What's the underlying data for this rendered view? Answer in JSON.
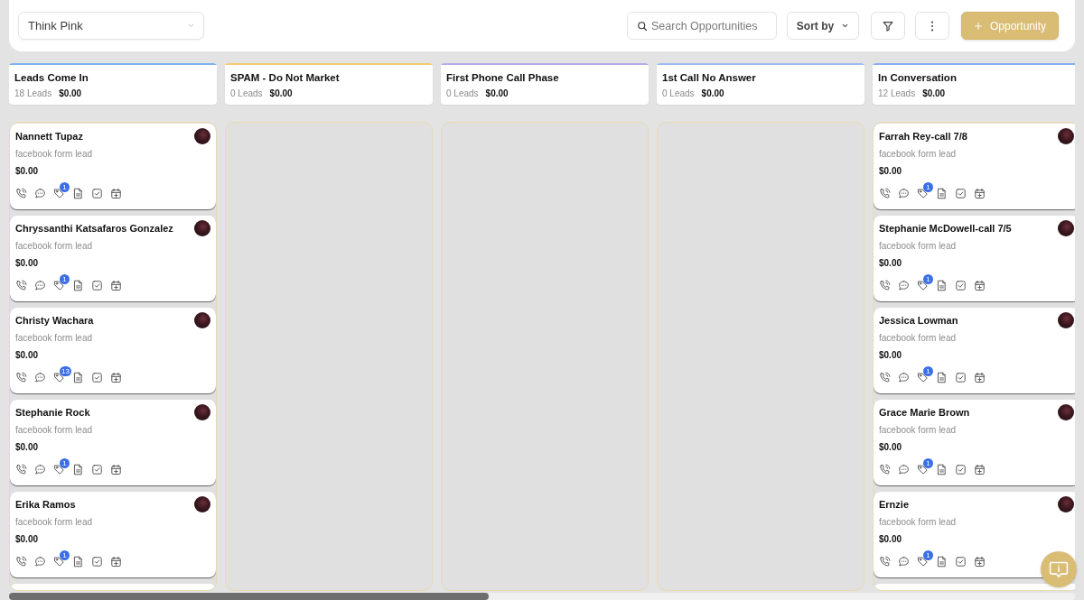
{
  "pipeline_select": {
    "value": "Think Pink"
  },
  "toolbar": {
    "search": {
      "placeholder": "Search Opportunities"
    },
    "sort_button": {
      "label": "Sort by"
    },
    "add_button": {
      "label": "Opportunity"
    }
  },
  "columns": [
    {
      "title": "Leads Come In",
      "count": "18 Leads",
      "amount": "$0.00",
      "color": "#7cb2f2",
      "more_below": true,
      "cards": [
        {
          "name": "Nannett Tupaz",
          "source": "facebook form lead",
          "amount": "$0.00",
          "tag_count": "1"
        },
        {
          "name": "Chryssanthi Katsafaros Gonzalez",
          "source": "facebook form lead",
          "amount": "$0.00",
          "tag_count": "1"
        },
        {
          "name": "Christy Wachara",
          "source": "facebook form lead",
          "amount": "$0.00",
          "tag_count": "13"
        },
        {
          "name": "Stephanie Rock",
          "source": "facebook form lead",
          "amount": "$0.00",
          "tag_count": "1"
        },
        {
          "name": "Erika Ramos",
          "source": "facebook form lead",
          "amount": "$0.00",
          "tag_count": "1"
        }
      ]
    },
    {
      "title": "SPAM - Do Not Market",
      "count": "0 Leads",
      "amount": "$0.00",
      "color": "#f2cc6e",
      "more_below": false
    },
    {
      "title": "First Phone Call Phase",
      "count": "0 Leads",
      "amount": "$0.00",
      "color": "#b7a9e8",
      "more_below": false
    },
    {
      "title": "1st Call No Answer",
      "count": "0 Leads",
      "amount": "$0.00",
      "color": "#9dbaf0",
      "more_below": false
    },
    {
      "title": "In Conversation",
      "count": "12 Leads",
      "amount": "$0.00",
      "color": "#86aef0",
      "more_below": true,
      "cards": [
        {
          "name": "Farrah Rey-call 7/8",
          "source": "facebook form lead",
          "amount": "$0.00",
          "tag_count": "1"
        },
        {
          "name": "Stephanie McDowell-call 7/5",
          "source": "facebook form lead",
          "amount": "$0.00",
          "tag_count": "1"
        },
        {
          "name": "Jessica Lowman",
          "source": "facebook form lead",
          "amount": "$0.00",
          "tag_count": "1"
        },
        {
          "name": "Grace Marie Brown",
          "source": "facebook form lead",
          "amount": "$0.00",
          "tag_count": "1"
        },
        {
          "name": "Ernzie",
          "source": "facebook form lead",
          "amount": "$0.00",
          "tag_count": "1"
        }
      ]
    }
  ]
}
